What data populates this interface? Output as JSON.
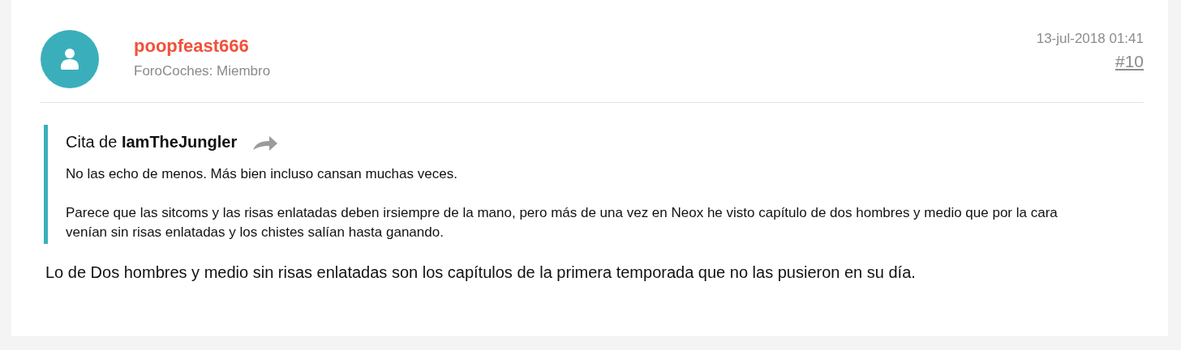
{
  "post": {
    "username": "poopfeast666",
    "user_title": "ForoCoches: Miembro",
    "date": "13-jul-2018 01:41",
    "post_number": "#10",
    "quote": {
      "header": "Cita de **IamTheJungler**",
      "paragraphs": [
        "No las echo de menos. Más bien incluso cansan muchas veces.",
        "Parece que las sitcoms y las risas enlatadas deben irsiempre de la mano, pero más de una vez en Neox he visto capítulo de dos hombres y medio que por la cara venían sin risas enlatadas y los chistes salían hasta ganando."
      ]
    },
    "body": "Lo de Dos hombres y medio sin risas enlatadas son los capítulos de la primera temporada que no las pusieron en su día."
  }
}
